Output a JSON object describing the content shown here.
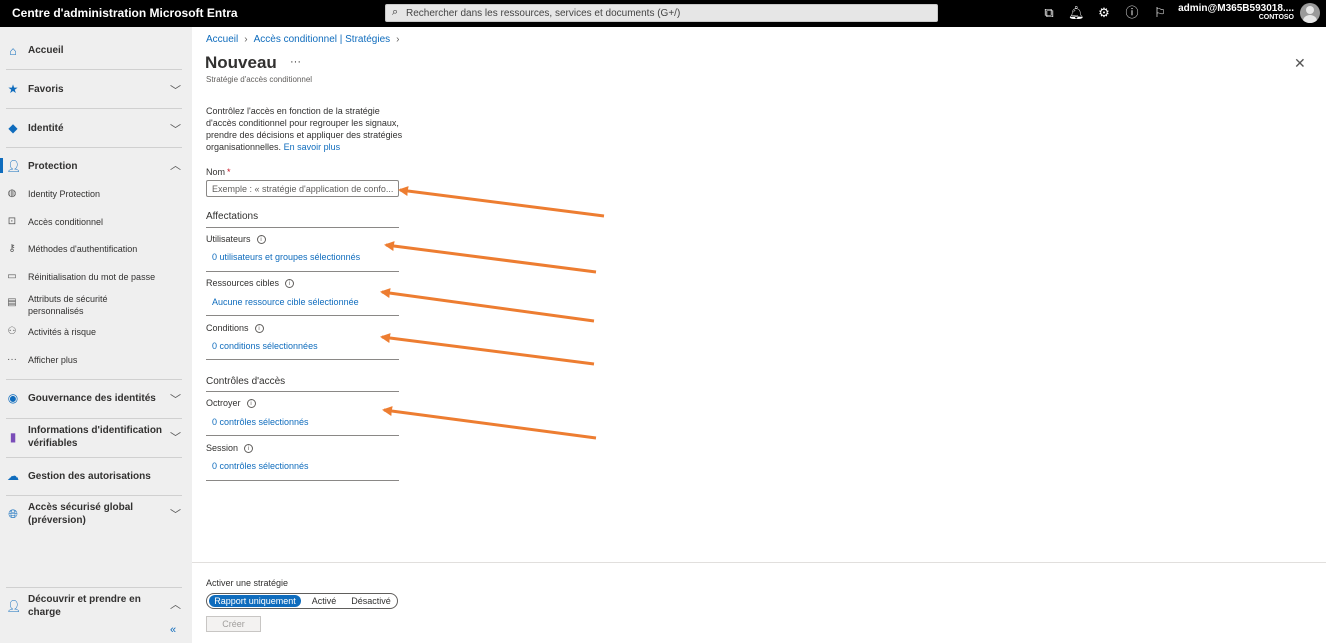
{
  "topbar": {
    "app_title": "Centre d'administration Microsoft Entra",
    "search_placeholder": "Rechercher dans les ressources, services et documents (G+/)",
    "account_name": "admin@M365B593018....",
    "account_org": "CONTOSO"
  },
  "sidebar": {
    "home": "Accueil",
    "favorites": "Favoris",
    "identity": "Identité",
    "protection": "Protection",
    "protection_items": [
      "Identity Protection",
      "Accès conditionnel",
      "Méthodes d'authentification",
      "Réinitialisation du mot de passe",
      "Attributs de sécurité personnalisés",
      "Activités à risque",
      "Afficher plus"
    ],
    "identity_governance": "Gouvernance des identités",
    "verifiable_credentials": "Informations d'identification vérifiables",
    "permissions_management": "Gestion des autorisations",
    "global_secure_access": "Accès sécurisé global (préversion)",
    "learn_support": "Découvrir et prendre en charge"
  },
  "breadcrumb": {
    "home": "Accueil",
    "section": "Accès conditionnel | Stratégies"
  },
  "page": {
    "title": "Nouveau",
    "subtitle": "Stratégie d'accès conditionnel",
    "description": "Contrôlez l'accès en fonction de la stratégie d'accès conditionnel pour regrouper les signaux, prendre des décisions et appliquer des stratégies organisationnelles.",
    "learn_more": "En savoir plus"
  },
  "form": {
    "name_label": "Nom",
    "name_placeholder": "Exemple : « stratégie d'application de confo...",
    "assignments_title": "Affectations",
    "users_label": "Utilisateurs",
    "users_value": "0 utilisateurs et groupes sélectionnés",
    "target_label": "Ressources cibles",
    "target_value": "Aucune ressource cible sélectionnée",
    "conditions_label": "Conditions",
    "conditions_value": "0 conditions sélectionnées",
    "access_controls_title": "Contrôles d'accès",
    "grant_label": "Octroyer",
    "grant_value": "0 contrôles sélectionnés",
    "session_label": "Session",
    "session_value": "0 contrôles sélectionnés"
  },
  "footer": {
    "enable_label": "Activer une stratégie",
    "options": [
      "Rapport uniquement",
      "Activé",
      "Désactivé"
    ],
    "selected_option": "Rapport uniquement",
    "create_button": "Créer"
  },
  "colors": {
    "accent": "#0f6cbd",
    "annotation_arrow": "#ed7d31"
  }
}
